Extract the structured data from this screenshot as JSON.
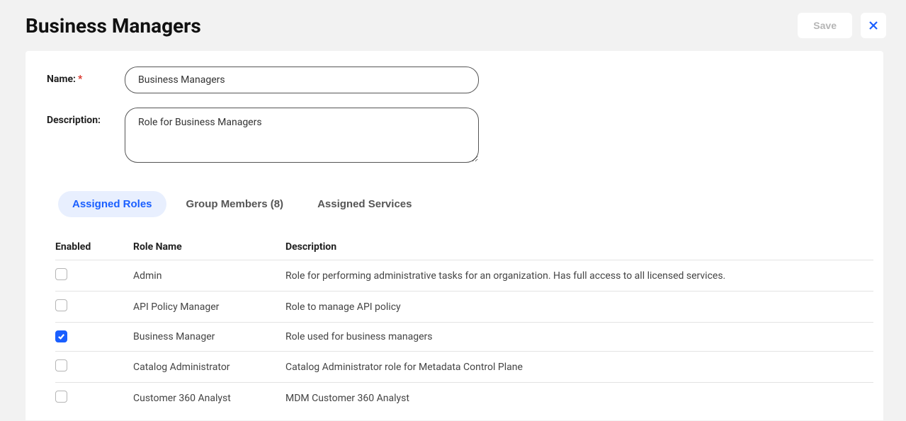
{
  "header": {
    "title": "Business Managers",
    "save_label": "Save"
  },
  "form": {
    "name_label": "Name:",
    "name_value": "Business Managers",
    "description_label": "Description:",
    "description_value": "Role for Business Managers"
  },
  "tabs": {
    "assigned_roles": "Assigned Roles",
    "group_members": "Group Members (8)",
    "assigned_services": "Assigned Services"
  },
  "table": {
    "columns": {
      "enabled": "Enabled",
      "role_name": "Role Name",
      "description": "Description"
    },
    "rows": [
      {
        "enabled": false,
        "role_name": "Admin",
        "description": "Role for performing administrative tasks for an organization. Has full access to all licensed services."
      },
      {
        "enabled": false,
        "role_name": "API Policy Manager",
        "description": "Role to manage API policy"
      },
      {
        "enabled": true,
        "role_name": "Business Manager",
        "description": "Role used for business managers"
      },
      {
        "enabled": false,
        "role_name": "Catalog Administrator",
        "description": "Catalog Administrator role for Metadata Control Plane"
      },
      {
        "enabled": false,
        "role_name": "Customer 360 Analyst",
        "description": "MDM Customer 360 Analyst"
      }
    ]
  }
}
